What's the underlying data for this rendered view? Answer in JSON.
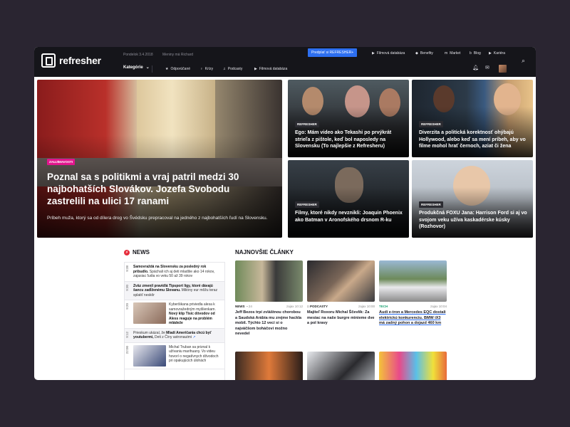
{
  "header": {
    "logo_text": "refresher",
    "date": "Pondelok 3.4.2018",
    "nameday": "Meniny má Richard",
    "promo_label": "Predplať si REFRESHER+",
    "top_nav": [
      "Filmová databáza",
      "Benefity",
      "Market",
      "Blog",
      "Kariéra"
    ],
    "category_label": "Kategórie",
    "sub_nav": [
      "Odporúčané",
      "Krízy",
      "Podcasty",
      "Filmová databáza"
    ]
  },
  "hero": {
    "main": {
      "tag": "ZAUJÍMAVOSTI",
      "title": "Poznal sa s politikmi a vraj patril medzi 30 najbohatších Slovákov. Jozefa Svobodu zastrelili na ulici 17 ranami",
      "desc": "Príbeh muža, ktorý sa od dílera drog vo Švédsku prepracoval na jedného z najbohatších ľudí na Slovensku."
    },
    "tiles": [
      {
        "tag": "REFRESHER",
        "title": "Ego: Mám video ako Tekashi po prvýkrát strieľa z pištole, keď bol naposledy na Slovensku (To najlepšie z Refresheru)"
      },
      {
        "tag": "REFRESHER",
        "title": "Diverzita a politická korektnosť ohýbajú Hollywood, alebo keď sa mení príbeh, aby vo filme mohol hrať černoch, aziat či žena"
      },
      {
        "tag": "REFRESHER",
        "title": "Filmy, ktoré nikdy nevznikli: Joaquin Phoenix ako Batman v Aronofského drsnom R-ku"
      },
      {
        "tag": "REFRESHER",
        "title": "Produkčná FOXU Jana: Harrison Ford si aj vo svojom veku užíva kaskadérske kúsky (Rozhovor)"
      }
    ]
  },
  "news": {
    "heading": "NEWS",
    "items": [
      {
        "time": "9:38",
        "bold": "Samovraždá na Slovensku za posledný rok pribudlo.",
        "text": "Spáchali ich aj deti mladšie ako 14 rokov, zajasiac ľudia vo veku 50 až 39 rokov"
      },
      {
        "time": "9:30",
        "bold": "Zväz zmenil pravidlá Tipsport ligy, ktoré dávajú šancu zadĺženému Slovanu.",
        "text": "Milióny eur môžu teraz splatiť neskôr"
      },
      {
        "time": "9:20",
        "pre": "Kyberšikana priviedla alesa k samovražedným myšlienkam.",
        "bold": "Nový klip Tisic dôvodov od Aless reaguje na problém mládeže",
        "text": ""
      },
      {
        "time": "9:12",
        "pre": "Prieskum ukázal, že",
        "bold": "Mladí Američania chcú byť youtubermi,",
        "text": "Deti z Číny astronautmi"
      },
      {
        "time": "22:00",
        "pre": "Michal Truban sa priznal k užívaniu marihuany. Vo videu hovorí o negatívnych dôvodoch pri opakujúcich úlohách",
        "bold": "",
        "text": ""
      }
    ]
  },
  "latest": {
    "heading": "NAJNOVŠIE ČLÁNKY",
    "cards": [
      {
        "cat": "NEWS",
        "comments": "24",
        "time": "zajax 10:12",
        "title": "Jeff Bezos trpí zvláštnou chorobou a Saudská Arábia mu zrejme hackla mobil. Týchto 12 vecí si o najväčšom boháčovi možno nevedel"
      },
      {
        "cat": "PODCASTY",
        "comments": "",
        "time": "zajax 10:00",
        "title": "Majiteľ Roxoru Michal Ščevlík: Za mesiac na naše burgre minieme dve a pol kravy"
      },
      {
        "cat": "TECH",
        "comments": "",
        "time": "zajax 10:04",
        "title": "Audi e-tron a Mercedes EQC dostali elektrickú konkurenciu. BMW iX3 má zadný pohon a dojazd 460 km"
      }
    ]
  },
  "colors": {
    "accent": "#2d6ff0",
    "tag_pink": "#e2168d",
    "news_red": "#e62d3c",
    "dark": "#15151a"
  }
}
